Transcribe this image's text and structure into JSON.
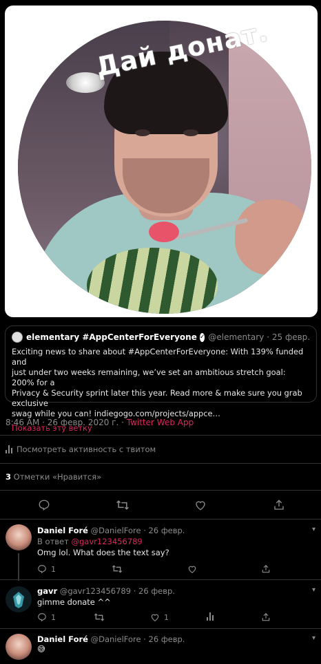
{
  "image_caption": "Дай донат.",
  "quoted_tweet": {
    "name": "elementary #AppCenterForEveryone",
    "handle": "@elementary",
    "date": "· 25 февр.",
    "text_lines": [
      "Exciting news to share about #AppCenterForEveryone: With 139% funded and",
      "just under two weeks remaining, we’ve set an ambitious stretch goal: 200% for a",
      "Privacy & Security sprint later this year. Read more & make sure you grab exclusive",
      "swag while you can! indiegogo.com/projects/appce…"
    ],
    "show_thread": "Показать эту ветку"
  },
  "tweet_meta": {
    "time_date": "8:46 AM · 26 февр. 2020 г. · ",
    "source": "Twitter Web App"
  },
  "activity_link": "Посмотреть активность с твитом",
  "likes": {
    "count": "3",
    "label": " Отметки «Нравится»"
  },
  "replies": [
    {
      "name": "Daniel Foré",
      "handle": "@DanielFore",
      "date": "· 26 февр.",
      "in_reply_prefix": "В ответ ",
      "in_reply_mention": "@gavr123456789",
      "text": "Omg lol. What does the text say?",
      "reply_count": "1",
      "retweet_count": "",
      "like_count": ""
    },
    {
      "name": "gavr",
      "handle": "@gavr123456789",
      "date": "· 26 февр.",
      "text": "gimme donate  ^^",
      "reply_count": "1",
      "retweet_count": "",
      "like_count": "1"
    },
    {
      "name": "Daniel Foré",
      "handle": "@DanielFore",
      "date": "· 26 февр.",
      "text": "😅"
    }
  ],
  "colors": {
    "accent": "#e0245e",
    "background": "#000000",
    "divider": "#2f3336"
  }
}
